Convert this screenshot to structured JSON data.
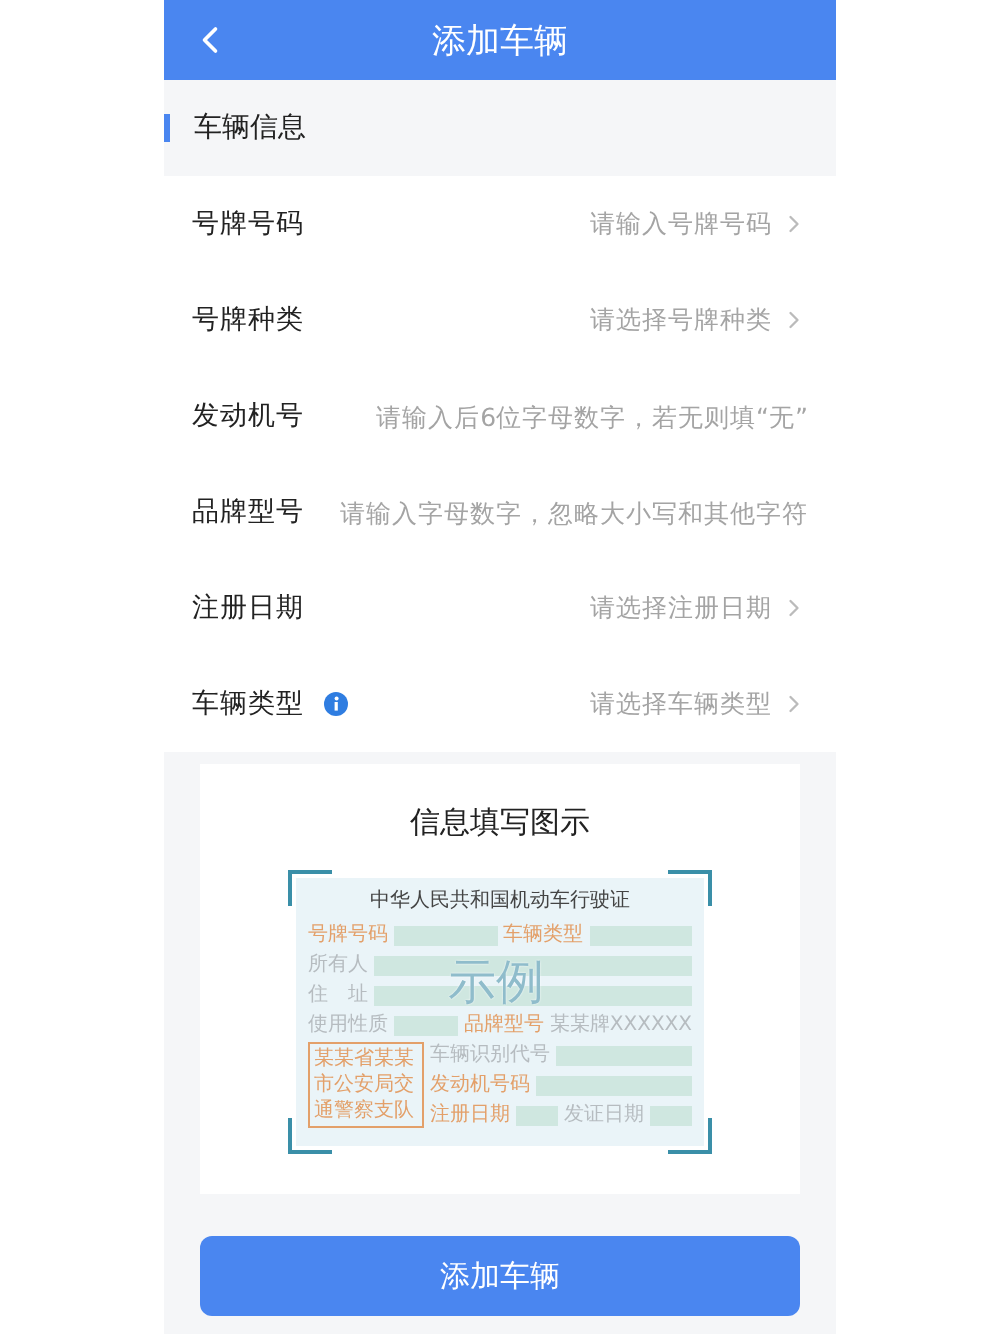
{
  "header": {
    "title": "添加车辆"
  },
  "section": {
    "title": "车辆信息"
  },
  "fields": [
    {
      "label": "号牌号码",
      "kind": "select",
      "placeholder": "请输入号牌号码",
      "info": false
    },
    {
      "label": "号牌种类",
      "kind": "select",
      "placeholder": "请选择号牌种类",
      "info": false
    },
    {
      "label": "发动机号",
      "kind": "input",
      "placeholder": "请输入后6位字母数字，若无则填“无”",
      "info": false
    },
    {
      "label": "品牌型号",
      "kind": "input",
      "placeholder": "请输入字母数字，忽略大小写和其他字符",
      "info": false
    },
    {
      "label": "注册日期",
      "kind": "select",
      "placeholder": "请选择注册日期",
      "info": false
    },
    {
      "label": "车辆类型",
      "kind": "select",
      "placeholder": "请选择车辆类型",
      "info": true
    }
  ],
  "guide": {
    "title": "信息填写图示",
    "license": {
      "title": "中华人民共和国机动车行驶证",
      "watermark": "示例",
      "stamp": "某某省某某市公安局交通警察支队",
      "top_rows": [
        [
          {
            "kind": "label",
            "text": "号牌号码",
            "highlight": true
          },
          {
            "kind": "blank"
          },
          {
            "kind": "label",
            "text": "车辆类型",
            "highlight": true
          },
          {
            "kind": "blank"
          }
        ],
        [
          {
            "kind": "label",
            "text": "所有人",
            "highlight": false
          },
          {
            "kind": "blank"
          }
        ],
        [
          {
            "kind": "label",
            "text": "住　址",
            "highlight": false
          },
          {
            "kind": "blank"
          }
        ],
        [
          {
            "kind": "label",
            "text": "使用性质",
            "highlight": false
          },
          {
            "kind": "blank"
          },
          {
            "kind": "label",
            "text": "品牌型号",
            "highlight": true
          },
          {
            "kind": "value",
            "text": "某某牌XXXXXX"
          }
        ]
      ],
      "side_rows": [
        [
          {
            "kind": "label",
            "text": "车辆识别代号",
            "highlight": false
          },
          {
            "kind": "blank"
          }
        ],
        [
          {
            "kind": "label",
            "text": "发动机号码",
            "highlight": true
          },
          {
            "kind": "blank"
          }
        ],
        [
          {
            "kind": "label",
            "text": "注册日期",
            "highlight": true
          },
          {
            "kind": "blank"
          },
          {
            "kind": "label",
            "text": "发证日期",
            "highlight": false
          },
          {
            "kind": "blank"
          }
        ]
      ]
    }
  },
  "submit": {
    "label": "添加车辆"
  }
}
